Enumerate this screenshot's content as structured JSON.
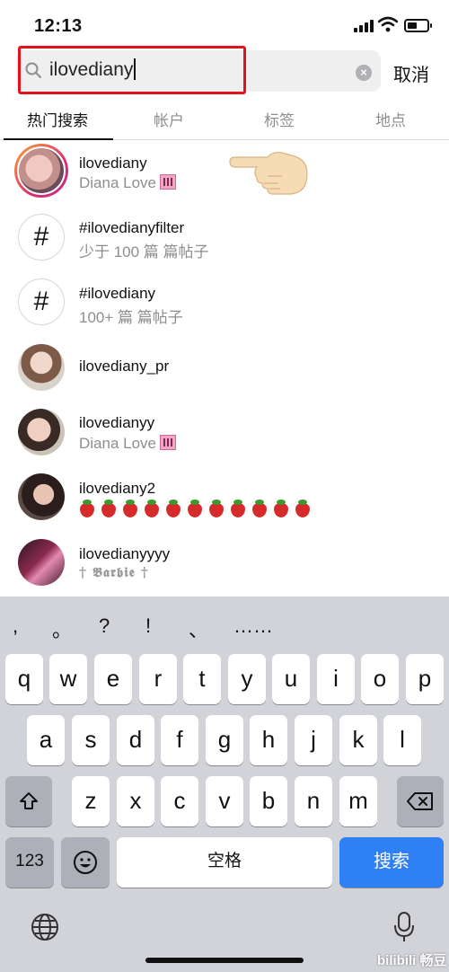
{
  "status_bar": {
    "time": "12:13"
  },
  "search": {
    "query": "ilovediany",
    "cancel_label": "取消"
  },
  "tabs": [
    {
      "label": "热门搜索",
      "active": true
    },
    {
      "label": "帐户",
      "active": false
    },
    {
      "label": "标签",
      "active": false
    },
    {
      "label": "地点",
      "active": false
    }
  ],
  "results": [
    {
      "name": "ilovediany",
      "subtitle": "Diana Love",
      "type": "account",
      "has_story_ring": true
    },
    {
      "name": "#ilovedianyfilter",
      "subtitle": "少于 100 篇 篇帖子",
      "type": "hashtag"
    },
    {
      "name": "#ilovediany",
      "subtitle": "100+ 篇 篇帖子",
      "type": "hashtag"
    },
    {
      "name": "ilovediany_pr",
      "subtitle": "",
      "type": "account"
    },
    {
      "name": "ilovedianyy",
      "subtitle": "Diana Love",
      "type": "account"
    },
    {
      "name": "ilovediany2",
      "subtitle": "🍓🍓🍓🍓🍓🍓🍓🍓🍓🍓🍓",
      "type": "account"
    },
    {
      "name": "ilovedianyyyy",
      "subtitle": "† 𝕭𝖆𝖗𝖇𝖎𝖊 †",
      "type": "account"
    }
  ],
  "keyboard": {
    "punctuation": [
      ",",
      "。",
      "?",
      "!",
      "、",
      "……"
    ],
    "row1": [
      "q",
      "w",
      "e",
      "r",
      "t",
      "y",
      "u",
      "i",
      "o",
      "p"
    ],
    "row2": [
      "a",
      "s",
      "d",
      "f",
      "g",
      "h",
      "j",
      "k",
      "l"
    ],
    "row3": [
      "z",
      "x",
      "c",
      "v",
      "b",
      "n",
      "m"
    ],
    "numbers_label": "123",
    "space_label": "空格",
    "return_label": "搜索"
  },
  "watermark": "bilibili 畅豆",
  "colors": {
    "highlight_red": "#e0121a",
    "return_blue": "#2f7ff5",
    "keyboard_bg": "#d1d3d9"
  }
}
